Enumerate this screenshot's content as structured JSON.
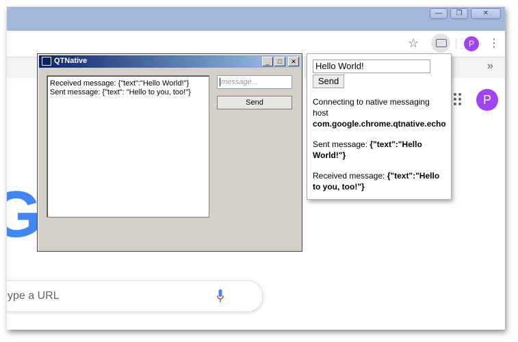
{
  "chrome": {
    "window_controls": {
      "minimize": "—",
      "restore": "❐",
      "close": "✕"
    },
    "profile_initial": "P",
    "bookmarks_more": "»",
    "search_placeholder": "ype a URL"
  },
  "qt": {
    "title": "QTNative",
    "buttons": {
      "minimize": "_",
      "maximize": "□",
      "close": "✕"
    },
    "log": [
      "Received message: {\"text\":\"Hello World!\"}",
      "Sent message: {\"text\": \"Hello to you, too!\"}"
    ],
    "input_placeholder": "message...",
    "send_label": "Send"
  },
  "popup": {
    "input_value": "Hello World!",
    "send_label": "Send",
    "connect_label": "Connecting to native messaging host",
    "host_name": "com.google.chrome.qtnative.echo",
    "sent_label": "Sent message: ",
    "sent_value": "{\"text\":\"Hello World!\"}",
    "received_label": "Received message: ",
    "received_value": "{\"text\":\"Hello to you, too!\"}"
  },
  "colors": {
    "titlebar": "#a4b8dd",
    "profile": "#a142f4",
    "qt_face": "#d4d0c8",
    "qt_title_start": "#0a246a"
  }
}
